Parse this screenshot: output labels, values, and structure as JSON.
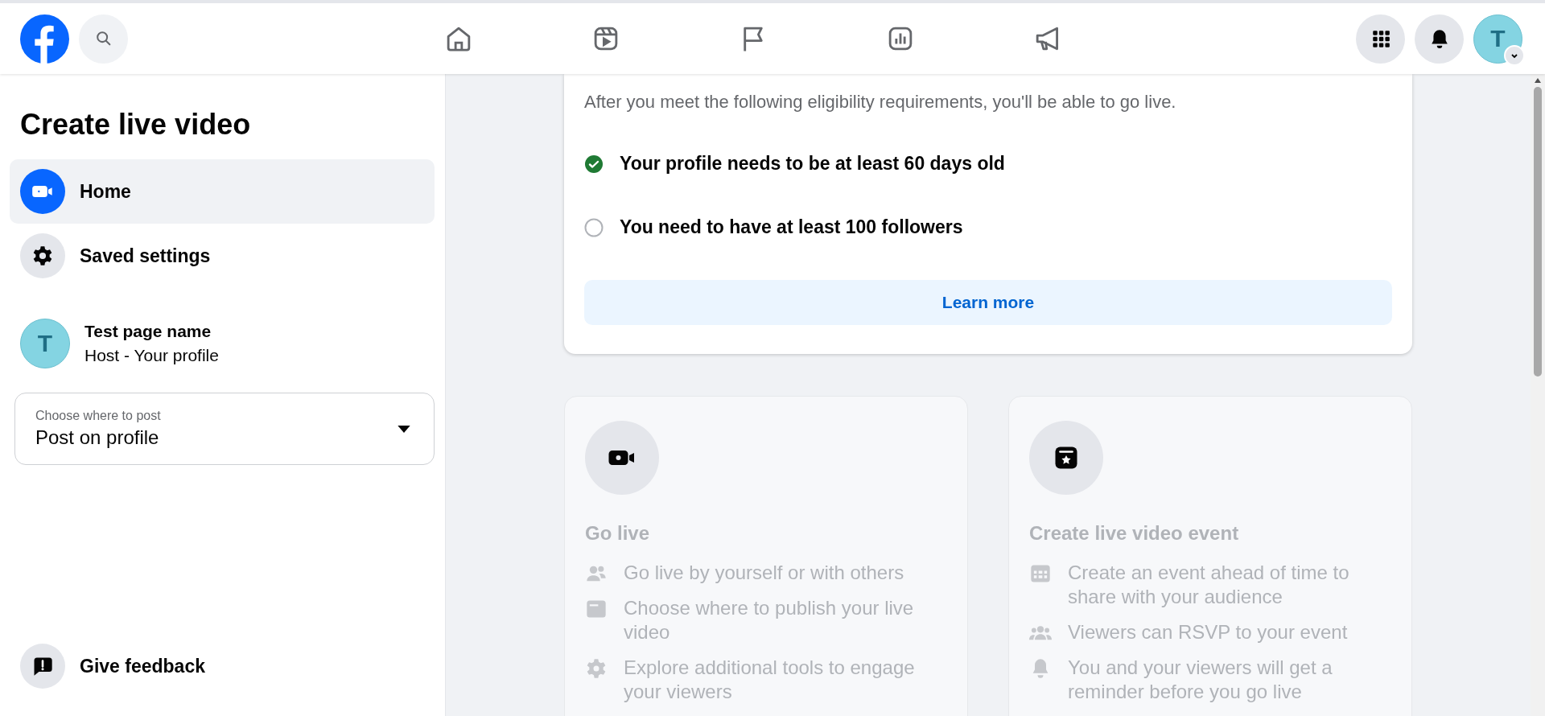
{
  "header": {
    "avatar_letter": "T"
  },
  "sidebar": {
    "title": "Create live video",
    "items": [
      {
        "kind": "video",
        "label": "Home",
        "selected": true
      },
      {
        "kind": "gear",
        "label": "Saved settings",
        "selected": false
      }
    ],
    "profile": {
      "avatar_letter": "T",
      "name": "Test page name",
      "role": "Host - Your profile"
    },
    "post_location": {
      "label": "Choose where to post",
      "value": "Post on profile"
    },
    "feedback": "Give feedback"
  },
  "eligibility": {
    "subtitle": "After you meet the following eligibility requirements, you'll be able to go live.",
    "requirements": [
      {
        "text": "Your profile needs to be at least 60 days old",
        "met": true
      },
      {
        "text": "You need to have at least 100 followers",
        "met": false
      }
    ],
    "button": "Learn more"
  },
  "options": [
    {
      "kind": "video",
      "title": "Go live",
      "disabled": true,
      "features": [
        {
          "kind": "people",
          "text": "Go live by yourself or with others"
        },
        {
          "kind": "window",
          "text": "Choose where to publish your live video"
        },
        {
          "kind": "gear",
          "text": "Explore additional tools to engage your viewers"
        }
      ]
    },
    {
      "kind": "event",
      "title": "Create live video event",
      "disabled": true,
      "features": [
        {
          "kind": "calendar",
          "text": "Create an event ahead of time to share with your audience"
        },
        {
          "kind": "group",
          "text": "Viewers can RSVP to your event"
        },
        {
          "kind": "bell",
          "text": "You and your viewers will get a reminder before you go live"
        }
      ]
    }
  ]
}
